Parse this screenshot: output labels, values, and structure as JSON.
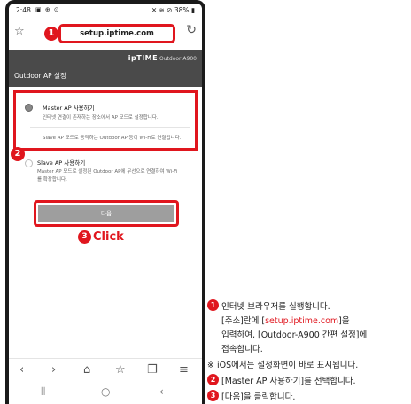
{
  "status_bar": {
    "time": "2:48",
    "icons_left": "▣ ⊕ ⊙",
    "icons_right": "✕ ≋ ⊘ 38% ▮"
  },
  "browser": {
    "url": "setup.iptime.com",
    "bookmark_icon": "star-outline-icon",
    "reload_icon": "reload-icon"
  },
  "header": {
    "logo_brand": "ipTIME",
    "logo_model": "Outdoor A900",
    "title": "Outdoor AP 설정"
  },
  "options": [
    {
      "title": "Master AP 사용하기",
      "desc1": "인터넷 연결이 존재하는 장소에서 AP 모드로 설정합니다.",
      "desc2": "Slave AP 모드로 동작하는 Outdoor AP 등이 Wi-Fi로 연결됩니다.",
      "selected": true
    },
    {
      "title": "Slave AP 사용하기",
      "desc1": "Master AP 모드로 설정된 Outdoor AP에 무선으로 연결하여 Wi-Fi",
      "desc2": "를 확장합니다.",
      "selected": false
    }
  ],
  "next_button": {
    "label": "다음"
  },
  "callouts": {
    "m1": "1",
    "m2": "2",
    "m3": "3",
    "click": "Click"
  },
  "nav_icons": [
    "back-icon",
    "forward-icon",
    "home-icon",
    "bookmarks-icon",
    "tabs-icon",
    "menu-icon"
  ],
  "nav_glyphs": {
    "back": "‹",
    "forward": "›",
    "home": "⌂",
    "bookmarks": "☆",
    "tabs": "❐",
    "menu": "≡"
  },
  "sys_glyphs": {
    "recent": "⦀",
    "home": "○",
    "back": "‹"
  },
  "instructions": {
    "step1_line1": "인터넷 브라우저를 실행합니다.",
    "step1_line2_pre": "[주소]란에 [",
    "step1_line2_url": "setup.iptime.com",
    "step1_line2_post": "]을",
    "step1_line3": "입력하여, [Outdoor-A900 간편 설정]에",
    "step1_line4": "접속합니다.",
    "note": "※ iOS에서는 설정화면이 바로 표시됩니다.",
    "step2": "[Master AP 사용하기]를 선택합니다.",
    "step3": "[다음]을 클릭합니다."
  },
  "colors": {
    "accent": "#e0161e",
    "header_bg": "#4a4a4a",
    "button_bg": "#9e9e9e"
  }
}
